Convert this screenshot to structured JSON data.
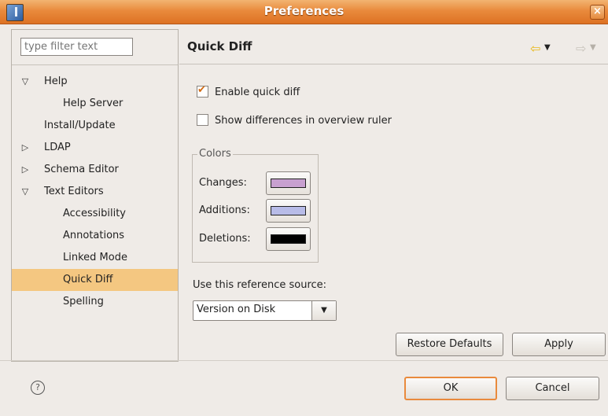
{
  "window": {
    "title": "Preferences",
    "close_glyph": "×"
  },
  "filter": {
    "placeholder": "type filter text"
  },
  "tree": {
    "items": [
      {
        "label": "Help",
        "toggle": "expanded",
        "level": 0
      },
      {
        "label": "Help Server",
        "toggle": "none",
        "level": 1
      },
      {
        "label": "Install/Update",
        "toggle": "none",
        "level": 0
      },
      {
        "label": "LDAP",
        "toggle": "collapsed",
        "level": 0
      },
      {
        "label": "Schema Editor",
        "toggle": "collapsed",
        "level": 0
      },
      {
        "label": "Text Editors",
        "toggle": "expanded",
        "level": 0
      },
      {
        "label": "Accessibility",
        "toggle": "none",
        "level": 1
      },
      {
        "label": "Annotations",
        "toggle": "none",
        "level": 1
      },
      {
        "label": "Linked Mode",
        "toggle": "none",
        "level": 1
      },
      {
        "label": "Quick Diff",
        "toggle": "none",
        "level": 1,
        "selected": true
      },
      {
        "label": "Spelling",
        "toggle": "none",
        "level": 1
      }
    ]
  },
  "page": {
    "title": "Quick Diff",
    "nav_back_icon": "back-arrow-icon",
    "nav_forward_icon": "forward-arrow-icon"
  },
  "options": {
    "enable_quick_diff": {
      "label": "Enable quick diff",
      "checked": true
    },
    "show_in_overview_ruler": {
      "label": "Show differences in overview ruler",
      "checked": false
    }
  },
  "colors": {
    "legend": "Colors",
    "changes": {
      "label": "Changes:",
      "color": "#c8a0d0"
    },
    "additions": {
      "label": "Additions:",
      "color": "#b8bce8"
    },
    "deletions": {
      "label": "Deletions:",
      "color": "#000000"
    }
  },
  "reference": {
    "label": "Use this reference source:",
    "selected": "Version on Disk"
  },
  "buttons": {
    "restore_defaults": "Restore Defaults",
    "apply": "Apply",
    "ok": "OK",
    "cancel": "Cancel"
  },
  "theme": {
    "accent": "#e98a3c",
    "selection": "#f4c781"
  }
}
